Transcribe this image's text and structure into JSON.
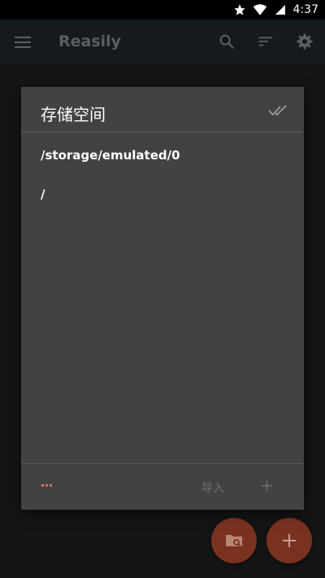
{
  "status_bar": {
    "time": "4:37",
    "icons": [
      "star-icon",
      "wifi-icon",
      "battery-icon"
    ]
  },
  "app_bar": {
    "title": "Reasily",
    "icons": [
      "menu-icon",
      "search-icon",
      "sort-icon",
      "settings-icon"
    ]
  },
  "dialog": {
    "title": "存储空间",
    "paths": [
      "/storage/emulated/0",
      "/"
    ],
    "footer": {
      "import_label": "导入",
      "add_label": "+"
    }
  },
  "fabs": [
    "folder-search-icon",
    "add-icon"
  ],
  "colors": {
    "accent": "#7a3220",
    "dialog_bg": "#424242",
    "more_dots": "#e0745a"
  }
}
